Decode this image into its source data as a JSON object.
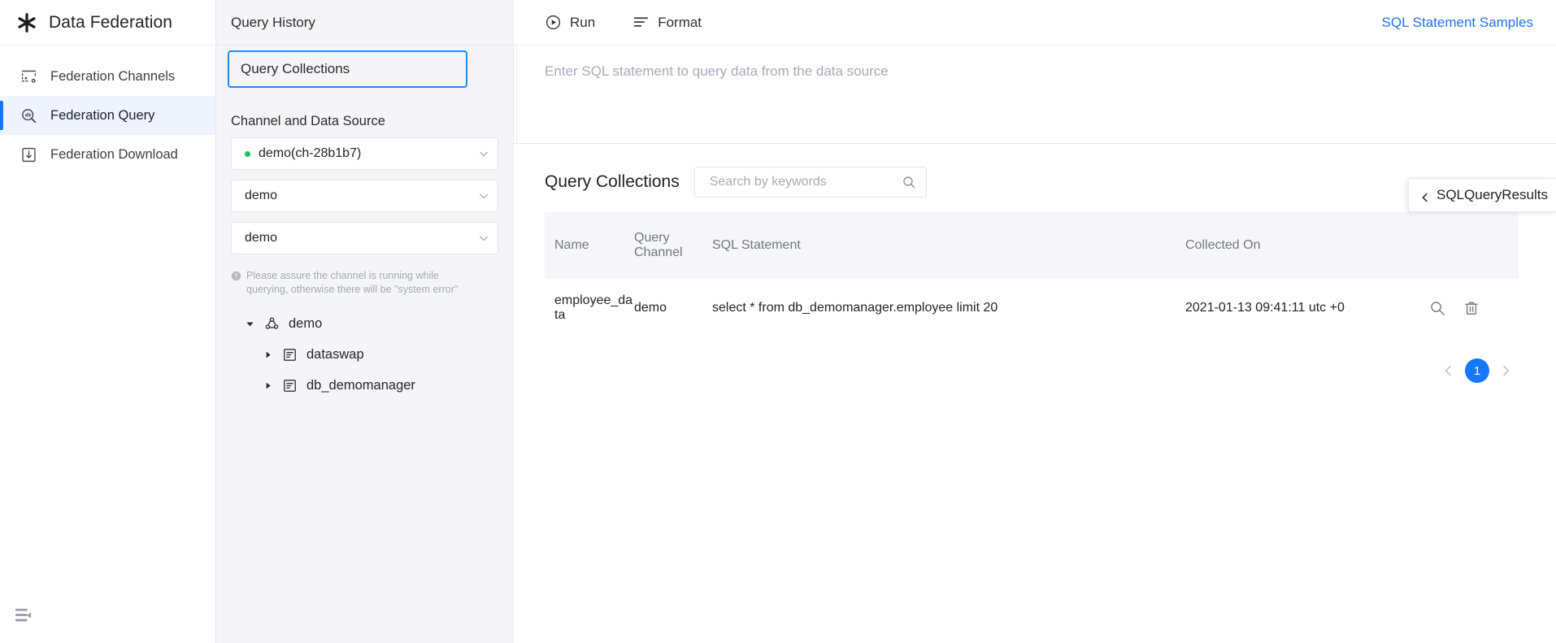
{
  "app": {
    "brand_title": "Data Federation",
    "brand_icon": "asterisk-logo-icon"
  },
  "sidebar": {
    "items": [
      {
        "label": "Federation Channels",
        "icon": "channels-icon",
        "active": false
      },
      {
        "label": "Federation Query",
        "icon": "query-magnifier-icon",
        "active": true
      },
      {
        "label": "Federation Download",
        "icon": "download-box-icon",
        "active": false
      }
    ],
    "collapse_icon": "collapse-sidebar-icon"
  },
  "query_panel": {
    "tabs": [
      {
        "label": "Query History",
        "selected": false
      },
      {
        "label": "Query Collections",
        "selected": true
      }
    ],
    "section_title": "Channel and Data Source",
    "selects": [
      {
        "value": "demo(ch-28b1b7)",
        "status": "running",
        "status_color": "#16c45f"
      },
      {
        "value": "demo",
        "status": "",
        "status_color": ""
      },
      {
        "value": "demo",
        "status": "",
        "status_color": ""
      }
    ],
    "hint": "Please assure the channel is running while querying, otherwise there will be \"system error\"",
    "hint_icon": "info-circle-icon",
    "tree": [
      {
        "label": "demo",
        "level": 1,
        "expanded": true,
        "icon": "channel-node-icon"
      },
      {
        "label": "dataswap",
        "level": 2,
        "expanded": false,
        "icon": "database-icon"
      },
      {
        "label": "db_demomanager",
        "level": 2,
        "expanded": false,
        "icon": "database-icon"
      }
    ]
  },
  "toolbar": {
    "run_label": "Run",
    "run_icon": "play-circle-icon",
    "format_label": "Format",
    "format_icon": "format-lines-icon",
    "samples_label": "SQL Statement Samples",
    "samples_color": "#2272ef"
  },
  "editor": {
    "placeholder": "Enter SQL statement to query data from the data source",
    "value": ""
  },
  "results": {
    "title": "Query Collections",
    "search": {
      "placeholder": "Search by keywords",
      "value": "",
      "icon": "search-icon"
    },
    "columns": [
      "Name",
      "Query Channel",
      "SQL Statement",
      "Collected On",
      ""
    ],
    "rows": [
      {
        "name": "employee_data",
        "channel": "demo",
        "sql": "select * from db_demomanager.employee limit 20",
        "collected_on": "2021-01-13 09:41:11 utc +0",
        "actions": [
          "search-icon",
          "delete-trash-icon"
        ]
      }
    ],
    "pagination": {
      "prev_icon": "chevron-left-icon",
      "next_icon": "chevron-right-icon",
      "current_page": "1",
      "accent_color": "#1677ff"
    }
  },
  "side_tab": {
    "label": "SQLQueryResults",
    "icon": "chevron-left-icon"
  }
}
